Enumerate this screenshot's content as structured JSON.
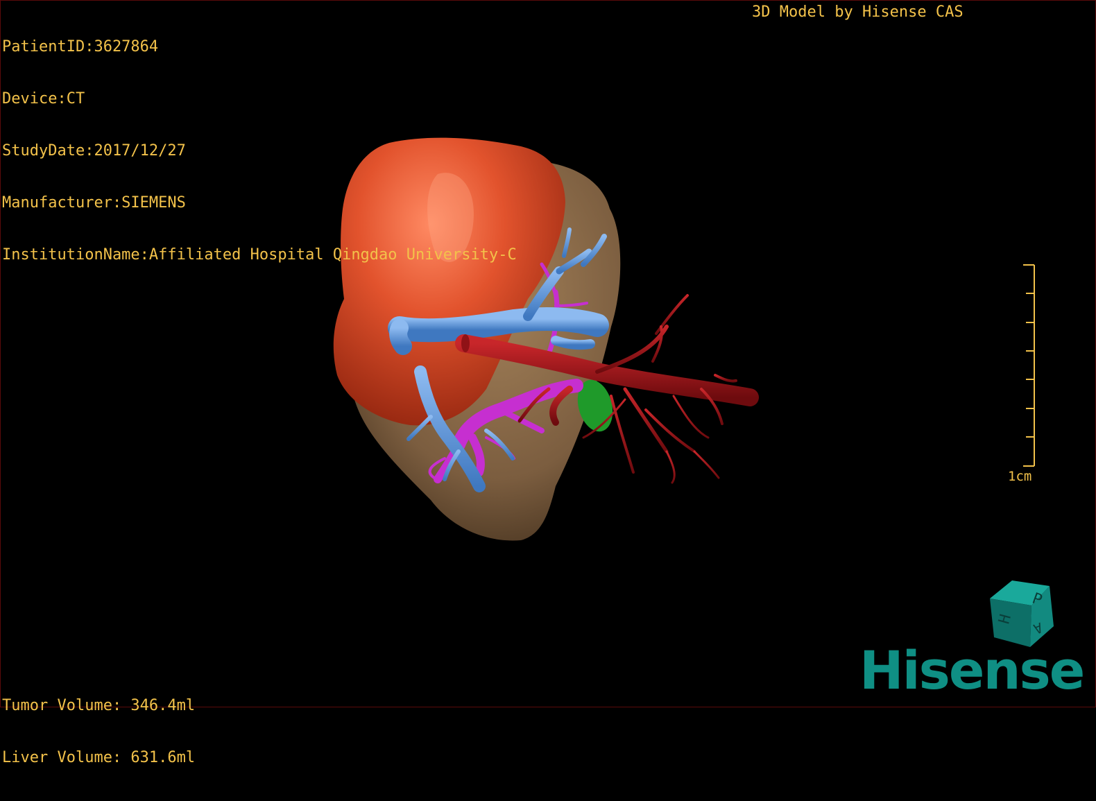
{
  "overlay": {
    "patient_id": "PatientID:3627864",
    "device": "Device:CT",
    "study_date": "StudyDate:2017/12/27",
    "manufacturer": "Manufacturer:SIEMENS",
    "institution": "InstitutionName:Affiliated Hospital Qingdao University-C",
    "model_credit": "3D Model by Hisense CAS",
    "tumor_volume": "Tumor Volume: 346.4ml",
    "liver_volume": "Liver Volume: 631.6ml",
    "scale_label": "1cm"
  },
  "orientation_cube": {
    "faces": [
      "P",
      "H",
      "A"
    ]
  },
  "brand_logo": "Hisense",
  "colors": {
    "overlay_text": "#f3c24a",
    "tumor": "#e2532d",
    "liver": "#8a6a48",
    "hepatic_vein": "#5a93d8",
    "portal_vein": "#c62fd0",
    "artery": "#a3161a",
    "gallbladder": "#1f9a2a",
    "brand": "#0f8f84"
  }
}
